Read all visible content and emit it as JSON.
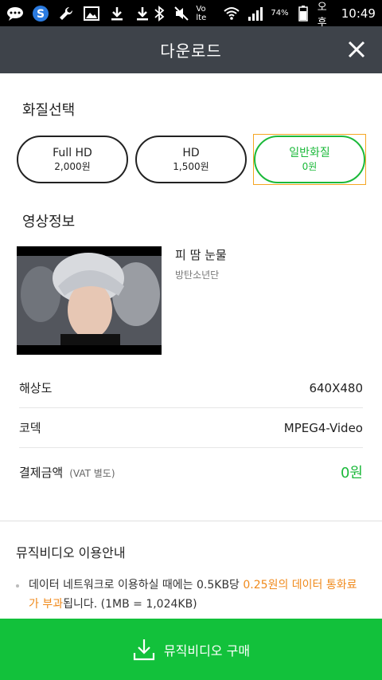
{
  "status_bar": {
    "battery": "74%",
    "period": "오후",
    "time": "10:49",
    "network": "Vo lte",
    "icons": [
      "chat-icon",
      "s-icon",
      "wrench-icon",
      "image-icon",
      "download-icon",
      "download-icon",
      "bluetooth-icon",
      "mute-icon",
      "volte-icon",
      "wifi-icon",
      "signal-icon",
      "battery-icon"
    ]
  },
  "header": {
    "title": "다운로드",
    "close_icon": "close-icon"
  },
  "quality": {
    "title": "화질선택",
    "options": [
      {
        "name": "Full HD",
        "price": "2,000원",
        "selected": false
      },
      {
        "name": "HD",
        "price": "1,500원",
        "selected": false
      },
      {
        "name": "일반화질",
        "price": "0원",
        "selected": true
      }
    ]
  },
  "video_info": {
    "title": "영상정보",
    "song_title": "피 땀 눈물",
    "artist": "방탄소년단",
    "rows": [
      {
        "label": "해상도",
        "value": "640X480"
      },
      {
        "label": "코덱",
        "value": "MPEG4-Video"
      },
      {
        "label": "결제금액",
        "sub": "(VAT 별도)",
        "value": "0원"
      }
    ]
  },
  "guide": {
    "title": "뮤직비디오 이용안내",
    "text_before": "데이터 네트워크로 이용하실 때에는 0.5KB당 ",
    "highlight": "0.25원의 데이터 통화료가 부과",
    "text_after": "됩니다. (1MB = 1,024KB)"
  },
  "buy_button": {
    "label": "뮤직비디오 구매",
    "icon": "download-icon"
  },
  "colors": {
    "accent_green": "#1bb93a",
    "buy_green": "#12c13b",
    "header_bg": "#3e434a",
    "highlight_orange": "#f08a1c"
  }
}
